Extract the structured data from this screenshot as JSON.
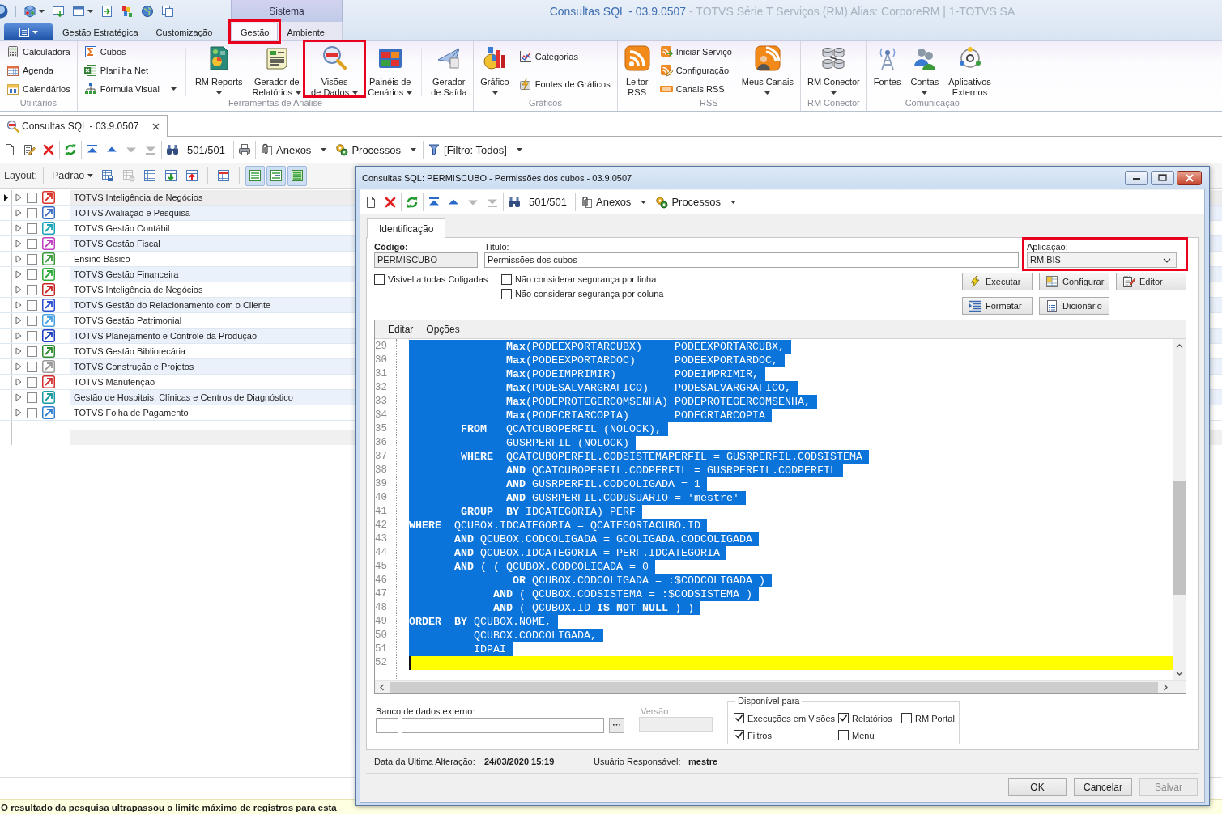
{
  "window": {
    "title": "Consultas SQL - 03.9.0507",
    "subtitle": "- TOTVS Série T Serviços (RM) Alias: CorporeRM | 1-TOTVS SA"
  },
  "ribbon": {
    "tabs": [
      {
        "label": "Gestão Estratégica",
        "selected": false,
        "highlighted": false
      },
      {
        "label": "Customização",
        "selected": false,
        "highlighted": false
      }
    ],
    "context_group": {
      "label": "Sistema",
      "tabs": [
        {
          "label": "Gestão",
          "selected": true,
          "highlighted": true
        },
        {
          "label": "Ambiente",
          "selected": false,
          "highlighted": false
        }
      ]
    },
    "groups": [
      {
        "label": "Utilitários",
        "sections": [
          [
            {
              "kind": "small",
              "label": "Calculadora",
              "dropdown": false,
              "highlighted": false
            },
            {
              "kind": "small",
              "label": "Agenda",
              "dropdown": false,
              "highlighted": false
            },
            {
              "kind": "small",
              "label": "Calendários",
              "dropdown": false,
              "highlighted": false
            }
          ]
        ]
      },
      {
        "label": "Ferramentas de Análise",
        "sections": [
          [
            {
              "kind": "small",
              "label": "Cubos",
              "dropdown": false,
              "highlighted": false
            },
            {
              "kind": "small",
              "label": "Planilha Net",
              "dropdown": false,
              "highlighted": false
            },
            {
              "kind": "small",
              "label": "Fórmula Visual",
              "dropdown": true,
              "highlighted": false
            }
          ],
          [
            {
              "kind": "large",
              "label": "RM Reports",
              "dropdown": true,
              "highlighted": false
            },
            {
              "kind": "large",
              "label": "Gerador de\nRelatórios",
              "dropdown": true,
              "highlighted": false
            },
            {
              "kind": "large",
              "label": "Visões\nde Dados",
              "dropdown": true,
              "highlighted": true
            },
            {
              "kind": "large",
              "label": "Painéis de\nCenários",
              "dropdown": true,
              "highlighted": false
            }
          ],
          [
            {
              "kind": "large",
              "label": "Gerador\nde Saída",
              "dropdown": false,
              "highlighted": false
            }
          ]
        ]
      },
      {
        "label": "Gráficos",
        "sections": [
          [
            {
              "kind": "large",
              "label": "Gráfico",
              "dropdown": true,
              "highlighted": false
            },
            {
              "kind": "small",
              "label": "Categorias",
              "dropdown": false,
              "highlighted": false
            },
            {
              "kind": "small",
              "label": "Fontes de Gráficos",
              "dropdown": false,
              "highlighted": false
            }
          ]
        ]
      },
      {
        "label": "RSS",
        "sections": [
          [
            {
              "kind": "large",
              "label": "Leitor\nRSS",
              "dropdown": false,
              "highlighted": false
            },
            {
              "kind": "small",
              "label": "Iniciar Serviço",
              "dropdown": false,
              "highlighted": false
            },
            {
              "kind": "small",
              "label": "Configuração",
              "dropdown": false,
              "highlighted": false
            },
            {
              "kind": "small",
              "label": "Canais RSS",
              "dropdown": false,
              "highlighted": false
            },
            {
              "kind": "large",
              "label": "Meus Canais",
              "dropdown": true,
              "highlighted": false
            }
          ]
        ]
      },
      {
        "label": "RM Conector",
        "sections": [
          [
            {
              "kind": "large",
              "label": "RM Conector",
              "dropdown": true,
              "highlighted": false
            }
          ]
        ]
      },
      {
        "label": "Comunicação",
        "sections": [
          [
            {
              "kind": "large",
              "label": "Fontes",
              "dropdown": false,
              "highlighted": false
            },
            {
              "kind": "large",
              "label": "Contas",
              "dropdown": true,
              "highlighted": false
            },
            {
              "kind": "large",
              "label": "Aplicativos\nExternos",
              "dropdown": false,
              "highlighted": false
            }
          ]
        ]
      }
    ]
  },
  "document_tabs": [
    {
      "label": "Consultas SQL - 03.9.0507",
      "selected": true
    }
  ],
  "toolbar": {
    "groups": [
      [
        {
          "kind": "icon",
          "disabled": false
        },
        {
          "kind": "icon",
          "disabled": false
        },
        {
          "kind": "icon",
          "disabled": false
        }
      ],
      [
        {
          "kind": "icon",
          "disabled": false
        }
      ],
      [
        {
          "kind": "icon",
          "disabled": false
        },
        {
          "kind": "icon",
          "disabled": false
        },
        {
          "kind": "icon",
          "disabled": true
        },
        {
          "kind": "icon",
          "disabled": true
        }
      ],
      [
        {
          "kind": "icon",
          "disabled": false
        },
        {
          "kind": "counter",
          "label": "501/501"
        }
      ],
      [
        {
          "kind": "icon",
          "disabled": false
        }
      ],
      [
        {
          "kind": "menu",
          "label": "Anexos"
        },
        {
          "kind": "menu",
          "label": "Processos"
        }
      ],
      [
        {
          "kind": "menu",
          "label": "[Filtro: Todos]"
        }
      ]
    ]
  },
  "layout_bar": {
    "label": "Layout:",
    "preset": "Padrão",
    "button_groups": [
      [
        {
          "disabled": false,
          "pressed": false
        },
        {
          "disabled": true,
          "pressed": false
        },
        {
          "disabled": false,
          "pressed": false
        },
        {
          "disabled": false,
          "pressed": false
        },
        {
          "disabled": false,
          "pressed": false
        }
      ],
      [
        {
          "disabled": false,
          "pressed": false
        }
      ],
      [
        {
          "disabled": false,
          "pressed": true
        },
        {
          "disabled": false,
          "pressed": true
        },
        {
          "disabled": false,
          "pressed": true
        }
      ]
    ]
  },
  "grid": {
    "rows": [
      {
        "label": "TOTVS Inteligência de Negócios",
        "selected": true,
        "expanded": false,
        "checked": false,
        "color": "#d9342b"
      },
      {
        "label": "TOTVS Avaliação e Pesquisa",
        "selected": false,
        "expanded": false,
        "checked": false,
        "color": "#3a6fc4"
      },
      {
        "label": "TOTVS Gestão Contábil",
        "selected": false,
        "expanded": false,
        "checked": false,
        "color": "#1aa3b8"
      },
      {
        "label": "TOTVS Gestão Fiscal",
        "selected": false,
        "expanded": false,
        "checked": false,
        "color": "#c03fc0"
      },
      {
        "label": "Ensino Básico",
        "selected": false,
        "expanded": false,
        "checked": false,
        "color": "#3a9a3a"
      },
      {
        "label": "TOTVS Gestão Financeira",
        "selected": false,
        "expanded": false,
        "checked": false,
        "color": "#2eaa3a"
      },
      {
        "label": "TOTVS Inteligência de Negócios",
        "selected": false,
        "expanded": false,
        "checked": false,
        "color": "#c62828"
      },
      {
        "label": "TOTVS Gestão do Relacionamento com o Cliente",
        "selected": false,
        "expanded": false,
        "checked": false,
        "color": "#2a4fcf"
      },
      {
        "label": "TOTVS Gestão Patrimonial",
        "selected": false,
        "expanded": false,
        "checked": false,
        "color": "#4aa3e0"
      },
      {
        "label": "TOTVS Planejamento e Controle da Produção",
        "selected": false,
        "expanded": false,
        "checked": false,
        "color": "#1a3fbf"
      },
      {
        "label": "TOTVS Gestão Bibliotecária",
        "selected": false,
        "expanded": false,
        "checked": false,
        "color": "#2e8b2e"
      },
      {
        "label": "TOTVS Construção e Projetos",
        "selected": false,
        "expanded": false,
        "checked": false,
        "color": "#9a9a9a"
      },
      {
        "label": "TOTVS Manutenção",
        "selected": false,
        "expanded": false,
        "checked": false,
        "color": "#d32f2f"
      },
      {
        "label": "Gestão de Hospitais, Clínicas e Centros de Diagnóstico",
        "selected": false,
        "expanded": false,
        "checked": false,
        "color": "#1a9aa0"
      },
      {
        "label": "TOTVS Folha de Pagamento",
        "selected": false,
        "expanded": false,
        "checked": false,
        "color": "#2f7fd0"
      }
    ]
  },
  "status_bar": {
    "message": "O resultado da pesquisa ultrapassou o limite máximo de registros para esta"
  },
  "dialog": {
    "title": "Consultas SQL: PERMISCUBO - Permissões dos cubos - 03.9.0507",
    "toolbar": {
      "groups": [
        [
          {
            "kind": "icon",
            "disabled": false
          },
          {
            "kind": "icon",
            "disabled": false
          }
        ],
        [
          {
            "kind": "icon",
            "disabled": false
          }
        ],
        [
          {
            "kind": "icon",
            "disabled": false
          },
          {
            "kind": "icon",
            "disabled": false
          },
          {
            "kind": "icon",
            "disabled": true
          },
          {
            "kind": "icon",
            "disabled": true
          }
        ],
        [
          {
            "kind": "icon",
            "disabled": false
          },
          {
            "kind": "counter",
            "label": "501/501"
          }
        ],
        [
          {
            "kind": "menu",
            "label": "Anexos"
          },
          {
            "kind": "menu",
            "label": "Processos"
          }
        ]
      ]
    },
    "tabs": [
      {
        "label": "Identificação",
        "selected": true
      }
    ],
    "fields": {
      "code": {
        "label": "Código:",
        "value": "PERMISCUBO"
      },
      "title": {
        "label": "Título:",
        "value": "Permissões dos cubos"
      },
      "application": {
        "label": "Aplicação:",
        "value": "RM BIS",
        "highlighted": true
      }
    },
    "options": [
      {
        "label": "Visível a todas Coligadas",
        "checked": false
      },
      {
        "label": "Não considerar segurança por linha",
        "checked": false
      },
      {
        "label": "Não considerar segurança por coluna",
        "checked": false
      }
    ],
    "actions": [
      {
        "label": "Executar"
      },
      {
        "label": "Configurar"
      },
      {
        "label": "Editor"
      },
      {
        "label": "Formatar"
      },
      {
        "label": "Dicionário"
      }
    ],
    "editor": {
      "menu": [
        "Editar",
        "Opções"
      ],
      "lines": [
        {
          "number": "29",
          "text": "               **Max**(PODEEXPORTARCUBX)     PODEEXPORTARCUBX,",
          "selected": true,
          "current": false
        },
        {
          "number": "30",
          "text": "               **Max**(PODEEXPORTARDOC)      PODEEXPORTARDOC,",
          "selected": true,
          "current": false
        },
        {
          "number": "31",
          "text": "               **Max**(PODEIMPRIMIR)         PODEIMPRIMIR,",
          "selected": true,
          "current": false
        },
        {
          "number": "32",
          "text": "               **Max**(PODESALVARGRAFICO)    PODESALVARGRAFICO,",
          "selected": true,
          "current": false
        },
        {
          "number": "33",
          "text": "               **Max**(PODEPROTEGERCOMSENHA) PODEPROTEGERCOMSENHA,",
          "selected": true,
          "current": false
        },
        {
          "number": "34",
          "text": "               **Max**(PODECRIARCOPIA)       PODECRIARCOPIA",
          "selected": true,
          "current": false
        },
        {
          "number": "35",
          "text": "        **FROM**   QCATCUBOPERFIL (NOLOCK),",
          "selected": true,
          "current": false
        },
        {
          "number": "36",
          "text": "               GUSRPERFIL (NOLOCK)",
          "selected": true,
          "current": false
        },
        {
          "number": "37",
          "text": "        **WHERE**  QCATCUBOPERFIL.CODSISTEMAPERFIL = GUSRPERFIL.CODSISTEMA",
          "selected": true,
          "current": false
        },
        {
          "number": "38",
          "text": "               **AND** QCATCUBOPERFIL.CODPERFIL = GUSRPERFIL.CODPERFIL",
          "selected": true,
          "current": false
        },
        {
          "number": "39",
          "text": "               **AND** GUSRPERFIL.CODCOLIGADA = 1",
          "selected": true,
          "current": false
        },
        {
          "number": "40",
          "text": "               **AND** GUSRPERFIL.CODUSUARIO = 'mestre'",
          "selected": true,
          "current": false
        },
        {
          "number": "41",
          "text": "        **GROUP**  **BY** IDCATEGORIA) PERF",
          "selected": true,
          "current": false
        },
        {
          "number": "42",
          "text": "**WHERE**  QCUBOX.IDCATEGORIA = QCATEGORIACUBO.ID",
          "selected": true,
          "current": false
        },
        {
          "number": "43",
          "text": "       **AND** QCUBOX.CODCOLIGADA = GCOLIGADA.CODCOLIGADA",
          "selected": true,
          "current": false
        },
        {
          "number": "44",
          "text": "       **AND** QCUBOX.IDCATEGORIA = PERF.IDCATEGORIA",
          "selected": true,
          "current": false
        },
        {
          "number": "45",
          "text": "       **AND** ( ( QCUBOX.CODCOLIGADA = 0",
          "selected": true,
          "current": false
        },
        {
          "number": "46",
          "text": "                **OR** QCUBOX.CODCOLIGADA = :$CODCOLIGADA )",
          "selected": true,
          "current": false
        },
        {
          "number": "47",
          "text": "             **AND** ( QCUBOX.CODSISTEMA = :$CODSISTEMA )",
          "selected": true,
          "current": false
        },
        {
          "number": "48",
          "text": "             **AND** ( QCUBOX.ID **IS** **NOT** **NULL** ) )",
          "selected": true,
          "current": false
        },
        {
          "number": "49",
          "text": "**ORDER**  **BY** QCUBOX.NOME,",
          "selected": true,
          "current": false
        },
        {
          "number": "50",
          "text": "          QCUBOX.CODCOLIGADA,",
          "selected": true,
          "current": false
        },
        {
          "number": "51",
          "text": "          IDPAI",
          "selected": true,
          "current": false
        },
        {
          "number": "52",
          "selected": false,
          "current": true
        }
      ]
    },
    "external_db": {
      "label": "Banco de dados externo:"
    },
    "version": {
      "label": "Versão:",
      "disabled": true
    },
    "available_for": {
      "title": "Disponível para",
      "options": [
        {
          "label": "Execuções em Visões",
          "checked": true
        },
        {
          "label": "Relatórios",
          "checked": true
        },
        {
          "label": "RM Portal",
          "checked": false
        },
        {
          "label": "Filtros",
          "checked": true
        },
        {
          "label": "Menu",
          "checked": false
        }
      ]
    },
    "last_change": {
      "label": "Data da Última Alteração:",
      "value": "24/03/2020 15:19"
    },
    "owner": {
      "label": "Usuário Responsável:",
      "value": "mestre"
    },
    "buttons": [
      {
        "label": "OK",
        "disabled": false
      },
      {
        "label": "Cancelar",
        "disabled": false
      },
      {
        "label": "Salvar",
        "disabled": true
      }
    ]
  }
}
